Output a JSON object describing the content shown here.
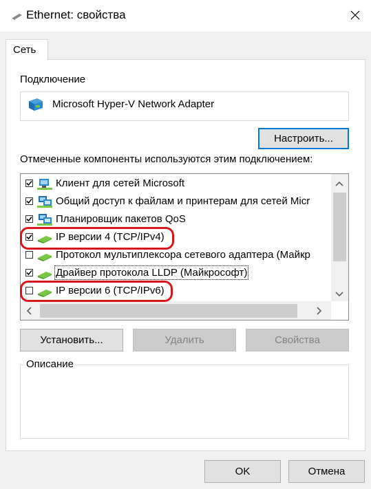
{
  "window": {
    "title": "Ethernet: свойства"
  },
  "tabs": [
    {
      "label": "Сеть"
    }
  ],
  "connection": {
    "label": "Подключение",
    "adapter_name": "Microsoft Hyper-V Network Adapter",
    "configure_label": "Настроить..."
  },
  "components": {
    "label": "Отмеченные компоненты используются этим подключением:",
    "items": [
      {
        "label": "Клиент для сетей Microsoft",
        "checked": true,
        "icon": "network-client-icon"
      },
      {
        "label": "Общий доступ к файлам и принтерам для сетей Micr",
        "checked": true,
        "icon": "network-service-icon"
      },
      {
        "label": "Планировщик пакетов QoS",
        "checked": true,
        "icon": "network-service-icon"
      },
      {
        "label": "IP версии 4 (TCP/IPv4)",
        "checked": true,
        "icon": "protocol-icon"
      },
      {
        "label": "Протокол мультиплексора сетевого адаптера (Майкр",
        "checked": false,
        "icon": "protocol-icon"
      },
      {
        "label": "Драйвер протокола LLDP (Майкрософт)",
        "checked": true,
        "icon": "protocol-icon"
      },
      {
        "label": "IP версии 6 (TCP/IPv6)",
        "checked": false,
        "icon": "protocol-icon"
      }
    ]
  },
  "buttons": {
    "install": "Установить...",
    "remove": "Удалить",
    "properties": "Свойства",
    "ok": "OK",
    "cancel": "Отмена"
  },
  "description": {
    "label": "Описание"
  },
  "colors": {
    "accent": "#0078d7",
    "annotation": "#d7161b"
  }
}
